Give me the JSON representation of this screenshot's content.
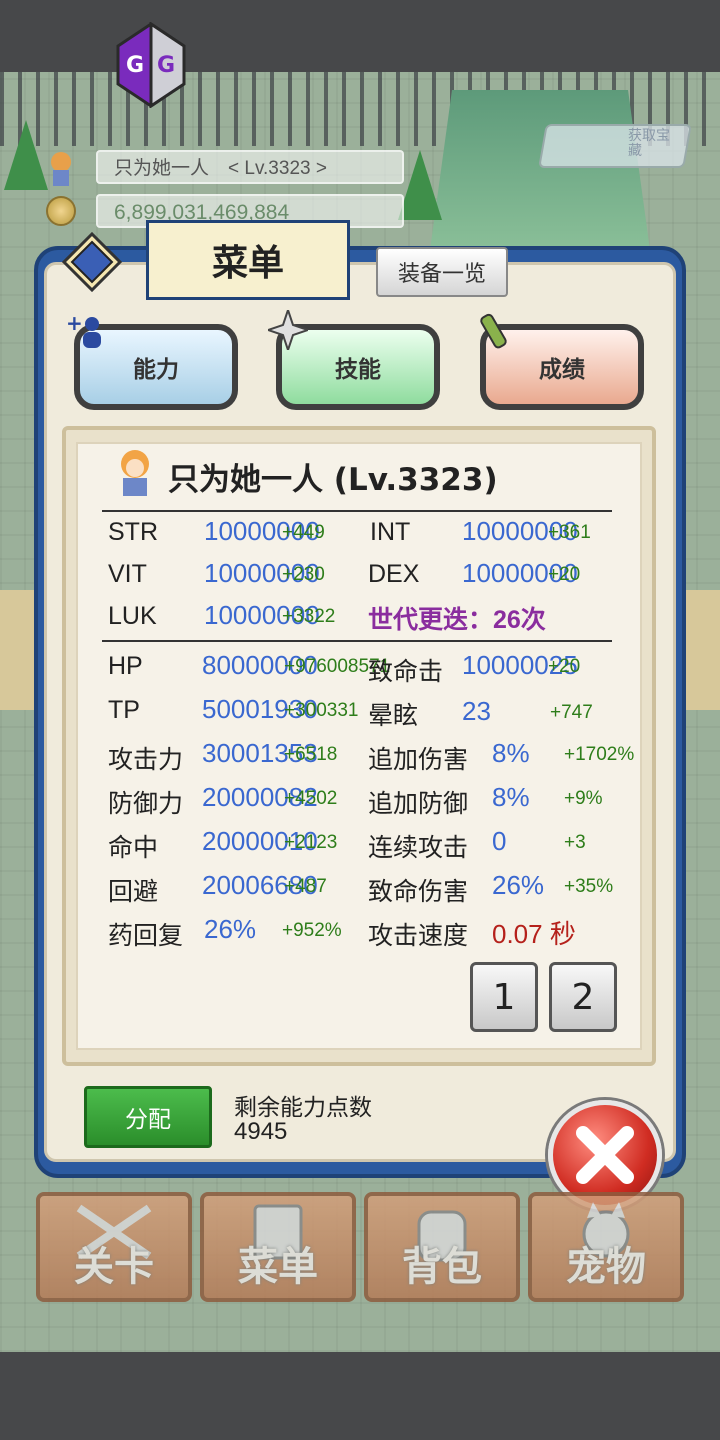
{
  "hud": {
    "player_line": "只为她一人　< Lv.3323 >",
    "gold": "6,899,031,469,884",
    "ribbon_text": "获取宝藏"
  },
  "menu": {
    "title": "菜单",
    "equip_list": "装备一览",
    "tabs": [
      {
        "label": "能力",
        "color": "#a8cfe6"
      },
      {
        "label": "技能",
        "color": "#8fdc9e"
      },
      {
        "label": "成绩",
        "color": "#e9a98f"
      }
    ]
  },
  "character": {
    "name": "只为她一人 (Lv.3323)"
  },
  "base_stats": [
    {
      "label": "STR",
      "value": "10000000",
      "bonus": "+449"
    },
    {
      "label": "VIT",
      "value": "10000000",
      "bonus": "+230"
    },
    {
      "label": "LUK",
      "value": "10000000",
      "bonus": "+3322"
    },
    {
      "label": "INT",
      "value": "10000000",
      "bonus": "+361"
    },
    {
      "label": "DEX",
      "value": "10000000",
      "bonus": "+20"
    }
  ],
  "generation": "世代更迭：26次",
  "left_stats": [
    {
      "label": "HP",
      "value": "80000000",
      "bonus": "+976008571"
    },
    {
      "label": "TP",
      "value": "50001930",
      "bonus": "+300331"
    },
    {
      "label": "攻击力",
      "value": "30001353",
      "bonus": "+6518"
    },
    {
      "label": "防御力",
      "value": "20000082",
      "bonus": "+4502"
    },
    {
      "label": "命中",
      "value": "20000010",
      "bonus": "+2123"
    },
    {
      "label": "回避",
      "value": "20006680",
      "bonus": "+487"
    },
    {
      "label": "药回复",
      "value": "26%",
      "bonus": "+952%"
    }
  ],
  "right_stats": [
    {
      "label": "致命击",
      "value": "10000025",
      "bonus": "+20"
    },
    {
      "label": "晕眩",
      "value": "23",
      "bonus": "+747"
    },
    {
      "label": "追加伤害",
      "value": "8%",
      "bonus": "+1702%"
    },
    {
      "label": "追加防御",
      "value": "8%",
      "bonus": "+9%"
    },
    {
      "label": "连续攻击",
      "value": "0",
      "bonus": "+3"
    },
    {
      "label": "致命伤害",
      "value": "26%",
      "bonus": "+35%"
    },
    {
      "label": "攻击速度",
      "value": "0.07 秒",
      "bonus": ""
    }
  ],
  "pages": [
    "1",
    "2"
  ],
  "allocate": {
    "button": "分配",
    "remaining_label": "剩余能力点数",
    "remaining_value": "4945"
  },
  "bottom_nav": [
    "关卡",
    "菜单",
    "背包",
    "宠物"
  ]
}
